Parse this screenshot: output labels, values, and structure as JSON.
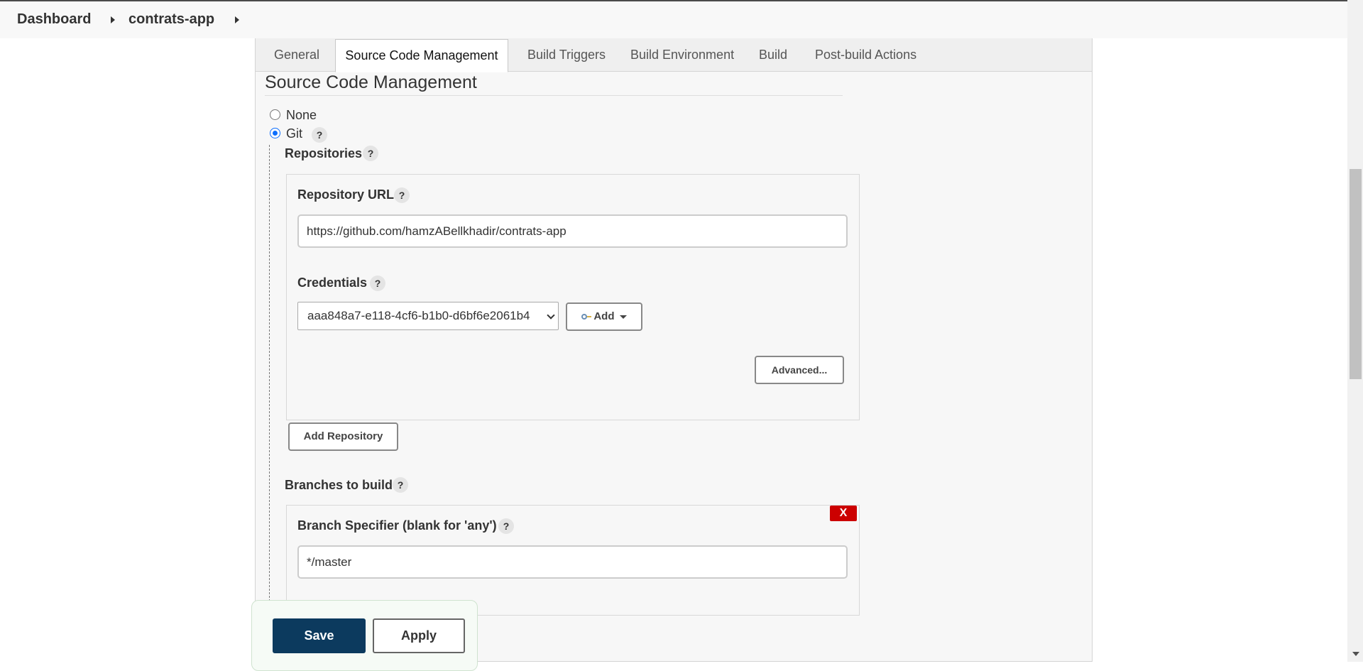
{
  "breadcrumb": {
    "items": [
      "Dashboard",
      "contrats-app"
    ]
  },
  "tabs": [
    {
      "label": "General",
      "active": false
    },
    {
      "label": "Source Code Management",
      "active": true
    },
    {
      "label": "Build Triggers",
      "active": false
    },
    {
      "label": "Build Environment",
      "active": false
    },
    {
      "label": "Build",
      "active": false
    },
    {
      "label": "Post-build Actions",
      "active": false
    }
  ],
  "scm": {
    "title": "Source Code Management",
    "options": [
      {
        "label": "None",
        "checked": false
      },
      {
        "label": "Git",
        "checked": true
      }
    ],
    "help": "?",
    "repositories": {
      "label": "Repositories",
      "url_label": "Repository URL",
      "url_value": "https://github.com/hamzABellkhadir/contrats-app",
      "credentials_label": "Credentials",
      "credentials_value": "aaa848a7-e118-4cf6-b1b0-d6bf6e2061b4",
      "add_label": "Add",
      "advanced_label": "Advanced...",
      "add_repository_label": "Add Repository"
    },
    "branches": {
      "label": "Branches to build",
      "specifier_label": "Branch Specifier (blank for 'any')",
      "specifier_value": "*/master",
      "delete_label": "X"
    }
  },
  "footer": {
    "save_label": "Save",
    "apply_label": "Apply"
  },
  "colors": {
    "save_bg": "#0c3a5e",
    "delete_bg": "#cc0000",
    "radio_accent": "#0d6efd"
  }
}
